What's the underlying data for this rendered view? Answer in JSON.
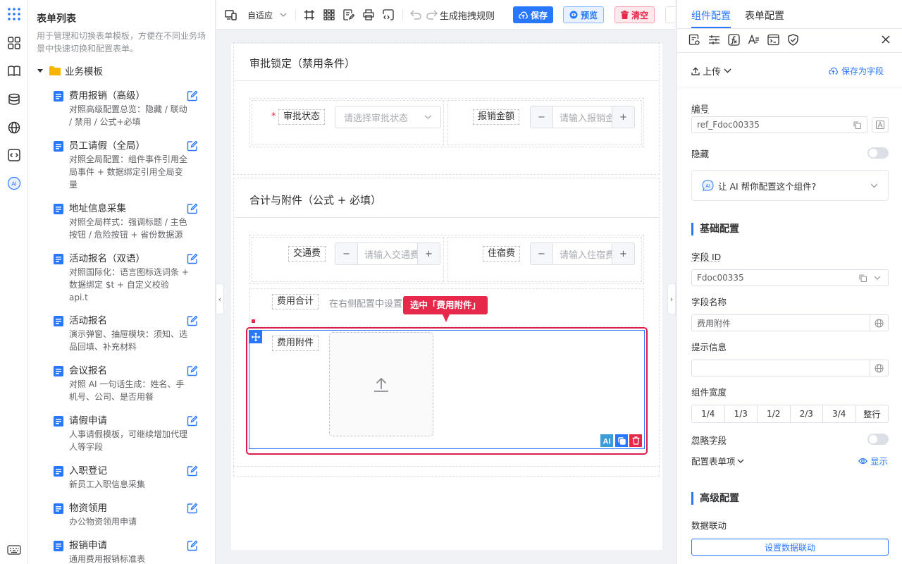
{
  "sidebar": {
    "title": "表单列表",
    "description": "用于管理和切换表单模板，方便在不同业务场景中快速切换和配置表单。",
    "folder": "业务模板",
    "items": [
      {
        "name": "费用报销（高级）",
        "desc": "对照高级配置总览：隐藏 / 联动 / 禁用 / 公式+必填"
      },
      {
        "name": "员工请假（全局）",
        "desc": "对照全局配置：组件事件引用全局事件 + 数据绑定引用全局变量"
      },
      {
        "name": "地址信息采集",
        "desc": "对照全局样式：强调标题 / 主色按钮 / 危险按钮 + 省份数据源"
      },
      {
        "name": "活动报名（双语）",
        "desc": "对照国际化：语言图标选词条 + 数据绑定 $t + 自定义校验 api.t"
      },
      {
        "name": "活动报名",
        "desc": "演示弹窗、抽屉模块：须知、选品回填、补充材料"
      },
      {
        "name": "会议报名",
        "desc": "对照 AI 一句话生成：姓名、手机号、公司、是否用餐"
      },
      {
        "name": "请假申请",
        "desc": "人事请假模板，可继续增加代理人等字段"
      },
      {
        "name": "入职登记",
        "desc": "新员工入职信息采集"
      },
      {
        "name": "物资领用",
        "desc": "办公物资领用申请"
      },
      {
        "name": "报销申请",
        "desc": "通用费用报销标准表"
      }
    ]
  },
  "toolbar": {
    "layout_mode": "自适应",
    "rules_label": "生成拖拽规则",
    "save_label": "保存",
    "preview_label": "预览",
    "clear_label": "清空"
  },
  "canvas": {
    "section1_title": "审批锁定（禁用条件）",
    "approval_status_label": "审批状态",
    "approval_status_placeholder": "请选择审批状态",
    "reimburse_amount_label": "报销金额",
    "reimburse_amount_placeholder": "请输入报销金额",
    "section2_title": "合计与附件（公式 + 必填）",
    "transport_label": "交通费",
    "transport_placeholder": "请输入交通费",
    "lodging_label": "住宿费",
    "lodging_placeholder": "请输入住宿费",
    "total_label": "费用合计",
    "total_hint": "在右侧配置中设置公式",
    "attachment_label": "费用附件",
    "callout": "选中「费用附件」",
    "required_mark": "*",
    "minus": "−",
    "plus": "+"
  },
  "right_panel": {
    "tabs": [
      "组件配置",
      "表单配置"
    ],
    "upload_label": "上传",
    "save_as_field": "保存为字段",
    "id_label": "编号",
    "id_value": "ref_Fdoc00335",
    "hidden_label": "隐藏",
    "ai_prompt": "让 AI 帮你配置这个组件?",
    "basic_header": "基础配置",
    "field_id_label": "字段 ID",
    "field_id_value": "Fdoc00335",
    "field_name_label": "字段名称",
    "field_name_value": "费用附件",
    "hint_label": "提示信息",
    "hint_value": "",
    "width_label": "组件宽度",
    "width_options": [
      "1/4",
      "1/3",
      "1/2",
      "2/3",
      "3/4",
      "整行"
    ],
    "ignore_label": "忽略字段",
    "config_items_label": "配置表单项",
    "show_label": "显示",
    "advanced_header": "高级配置",
    "linkage_label": "数据联动",
    "linkage_button": "设置数据联动"
  },
  "colors": {
    "primary": "#2878ff",
    "danger": "#e6294a",
    "selection": "#d81e4f"
  }
}
